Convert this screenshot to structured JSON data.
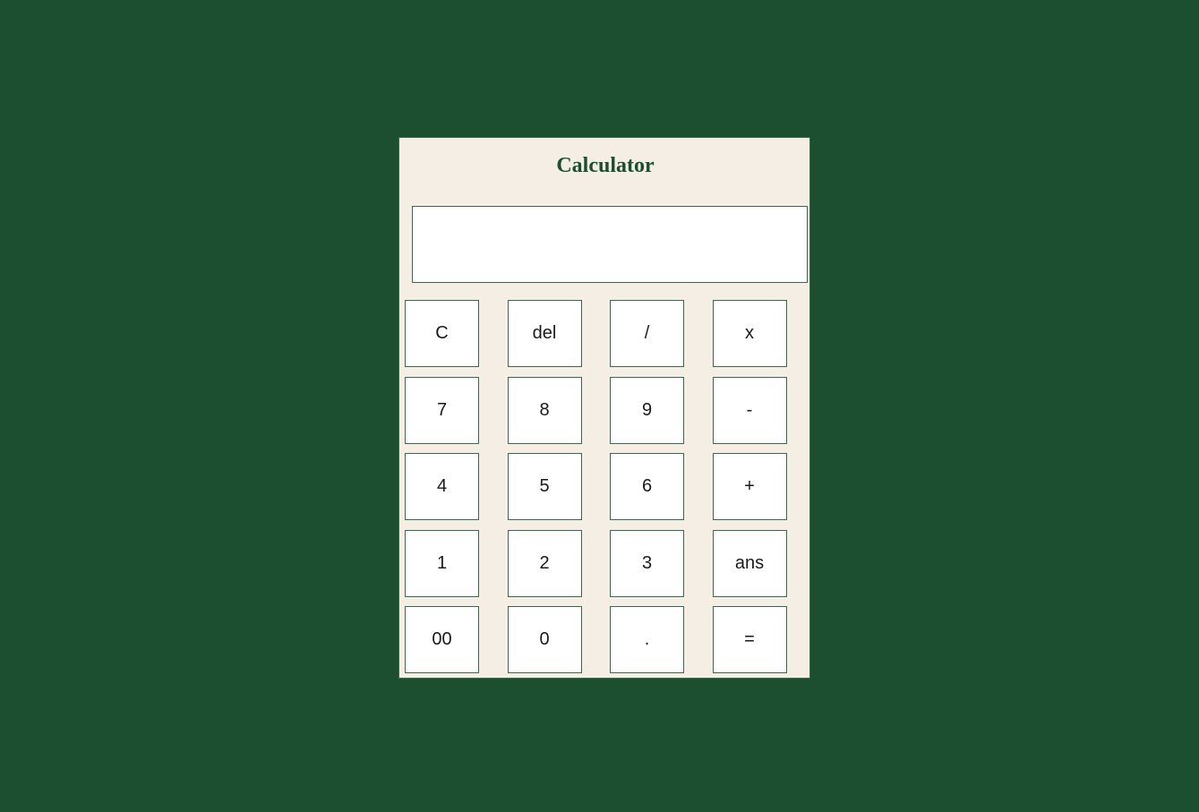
{
  "app": {
    "title": "Calculator"
  },
  "display": {
    "value": ""
  },
  "keys": [
    {
      "label": "C",
      "name": "clear-button"
    },
    {
      "label": "del",
      "name": "delete-button"
    },
    {
      "label": "/",
      "name": "divide-button"
    },
    {
      "label": "x",
      "name": "multiply-button"
    },
    {
      "label": "7",
      "name": "digit-7-button"
    },
    {
      "label": "8",
      "name": "digit-8-button"
    },
    {
      "label": "9",
      "name": "digit-9-button"
    },
    {
      "label": "-",
      "name": "subtract-button"
    },
    {
      "label": "4",
      "name": "digit-4-button"
    },
    {
      "label": "5",
      "name": "digit-5-button"
    },
    {
      "label": "6",
      "name": "digit-6-button"
    },
    {
      "label": "+",
      "name": "add-button"
    },
    {
      "label": "1",
      "name": "digit-1-button"
    },
    {
      "label": "2",
      "name": "digit-2-button"
    },
    {
      "label": "3",
      "name": "digit-3-button"
    },
    {
      "label": "ans",
      "name": "answer-button"
    },
    {
      "label": "00",
      "name": "double-zero-button"
    },
    {
      "label": "0",
      "name": "digit-0-button"
    },
    {
      "label": ".",
      "name": "decimal-button"
    },
    {
      "label": "=",
      "name": "equals-button"
    }
  ],
  "colors": {
    "page_background": "#1c4e30",
    "panel_background": "#f5eee5",
    "title_color": "#1c4e30",
    "border_color": "#3a6a4e"
  }
}
